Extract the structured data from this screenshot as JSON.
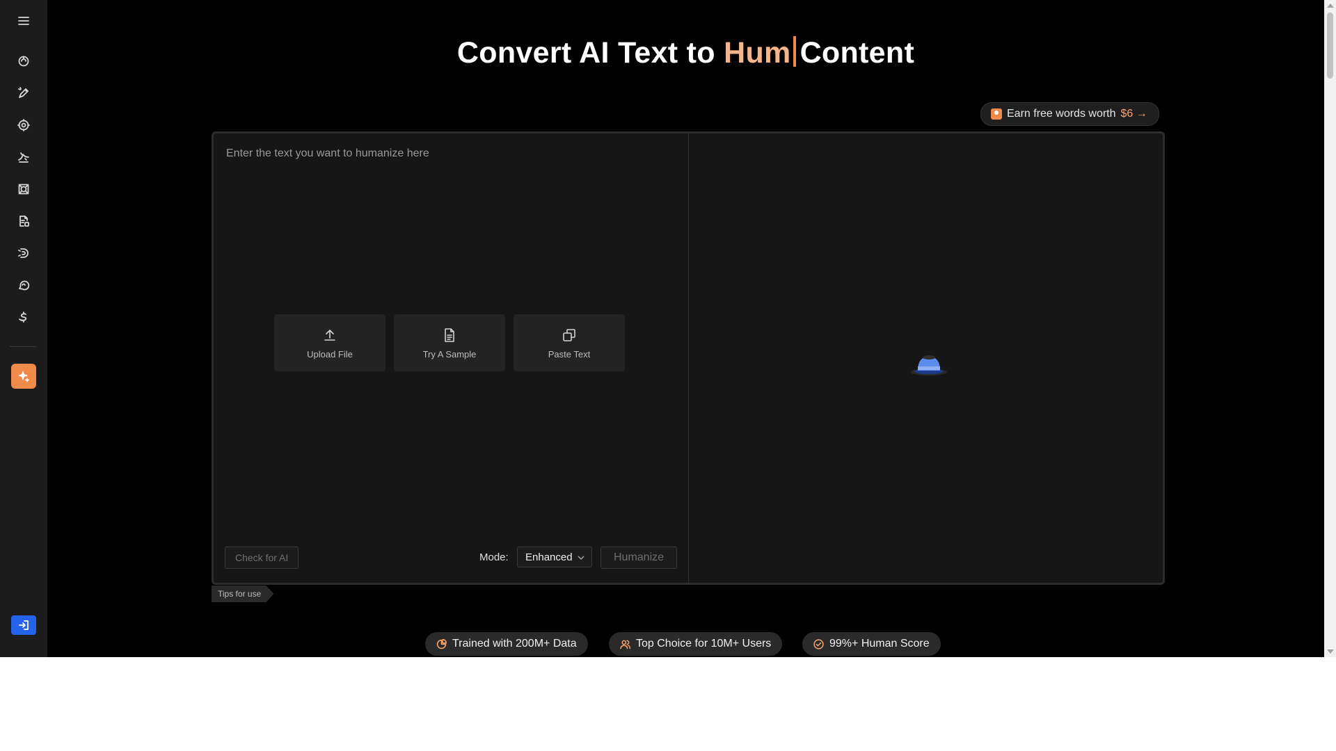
{
  "headline": {
    "prefix": "Convert AI Text to ",
    "accent": "Hum",
    "suffix": "Content"
  },
  "earn_pill": {
    "text": "Earn free words worth",
    "amount": "$6",
    "arrow": "→"
  },
  "editor": {
    "placeholder": "Enter the text you want to humanize here",
    "actions": {
      "upload": "Upload File",
      "sample": "Try A Sample",
      "paste": "Paste Text"
    },
    "check_ai_label": "Check for AI",
    "mode_label": "Mode:",
    "mode_value": "Enhanced",
    "humanize_label": "Humanize"
  },
  "tips_label": "Tips for use",
  "badges": [
    {
      "icon": "pie-chart-icon",
      "text": "Trained with 200M+ Data"
    },
    {
      "icon": "users-icon",
      "text": "Top Choice for 10M+ Users"
    },
    {
      "icon": "check-badge-icon",
      "text": "99%+ Human Score"
    }
  ],
  "sidebar": {
    "items": [
      "menu-icon",
      "ai-humanizer-icon",
      "ai-writer-icon",
      "ai-detector-icon",
      "paraphraser-icon",
      "grammar-checker-icon",
      "summarizer-icon",
      "plagiarism-icon",
      "chat-icon",
      "pricing-icon",
      "ai-sparkle-icon",
      "login-icon"
    ]
  },
  "colors": {
    "accent": "#f08a4b",
    "accent_text": "#f6b48a",
    "primary_blue": "#2563eb",
    "background": "#000000",
    "panel": "#161616"
  }
}
